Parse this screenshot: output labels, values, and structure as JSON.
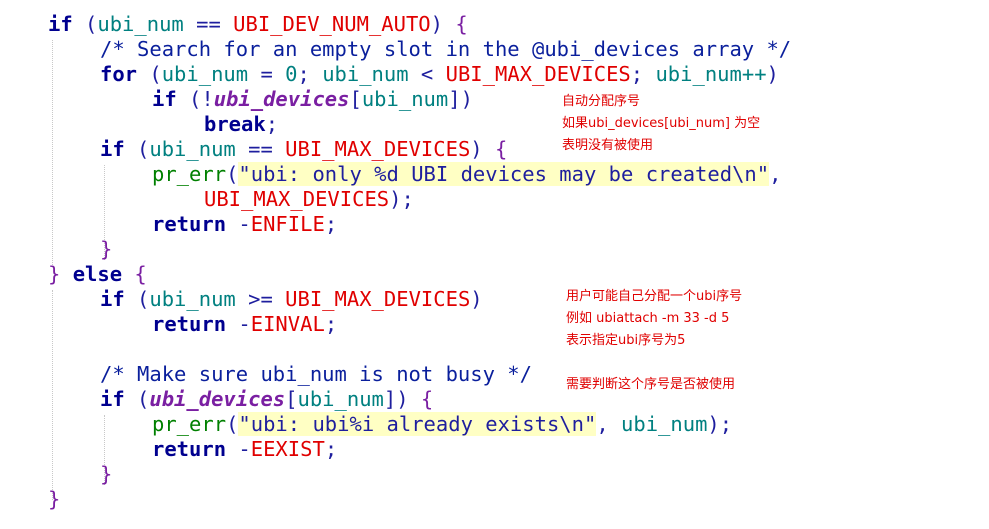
{
  "code": {
    "lines": [
      {
        "tokens": [
          [
            "kw",
            "if"
          ],
          [
            "pn",
            " ("
          ],
          [
            "id",
            "ubi_num"
          ],
          [
            "pn",
            " == "
          ],
          [
            "macro",
            "UBI_DEV_NUM_AUTO"
          ],
          [
            "pn",
            ") "
          ],
          [
            "br",
            "{"
          ]
        ]
      },
      {
        "tokens": [
          [
            "cm",
            "/* Search for an empty slot in the @ubi_devices array */"
          ]
        ]
      },
      {
        "tokens": [
          [
            "kw",
            "for"
          ],
          [
            "pn",
            " ("
          ],
          [
            "id",
            "ubi_num"
          ],
          [
            "pn",
            " = "
          ],
          [
            "id",
            "0"
          ],
          [
            "pn",
            "; "
          ],
          [
            "id",
            "ubi_num"
          ],
          [
            "pn",
            " < "
          ],
          [
            "macro",
            "UBI_MAX_DEVICES"
          ],
          [
            "pn",
            "; "
          ],
          [
            "id",
            "ubi_num++"
          ],
          [
            "pn",
            ")"
          ]
        ]
      },
      {
        "tokens": [
          [
            "kw",
            "if"
          ],
          [
            "pn",
            " (!"
          ],
          [
            "it",
            "ubi_devices"
          ],
          [
            "pn",
            "["
          ],
          [
            "id",
            "ubi_num"
          ],
          [
            "pn",
            "])"
          ]
        ]
      },
      {
        "tokens": [
          [
            "kw",
            "break"
          ],
          [
            "pn",
            ";"
          ]
        ]
      },
      {
        "tokens": [
          [
            "kw",
            "if"
          ],
          [
            "pn",
            " ("
          ],
          [
            "id",
            "ubi_num"
          ],
          [
            "pn",
            " == "
          ],
          [
            "macro",
            "UBI_MAX_DEVICES"
          ],
          [
            "pn",
            ") "
          ],
          [
            "br",
            "{"
          ]
        ]
      },
      {
        "tokens": [
          [
            "fn",
            "pr_err"
          ],
          [
            "pn",
            "("
          ],
          [
            "str",
            "\"ubi: only %d UBI devices may be created\\n\""
          ],
          [
            "pn",
            ","
          ]
        ]
      },
      {
        "tokens": [
          [
            "macro",
            "UBI_MAX_DEVICES"
          ],
          [
            "pn",
            ");"
          ]
        ]
      },
      {
        "tokens": [
          [
            "kw",
            "return"
          ],
          [
            "pn",
            " -"
          ],
          [
            "macro",
            "ENFILE"
          ],
          [
            "pn",
            ";"
          ]
        ]
      },
      {
        "tokens": [
          [
            "br",
            "}"
          ]
        ]
      },
      {
        "tokens": [
          [
            "br",
            "}"
          ],
          [
            "pn",
            " "
          ],
          [
            "kw",
            "else"
          ],
          [
            "pn",
            " "
          ],
          [
            "br",
            "{"
          ]
        ]
      },
      {
        "tokens": [
          [
            "kw",
            "if"
          ],
          [
            "pn",
            " ("
          ],
          [
            "id",
            "ubi_num"
          ],
          [
            "pn",
            " >= "
          ],
          [
            "macro",
            "UBI_MAX_DEVICES"
          ],
          [
            "pn",
            ")"
          ]
        ]
      },
      {
        "tokens": [
          [
            "kw",
            "return"
          ],
          [
            "pn",
            " -"
          ],
          [
            "macro",
            "EINVAL"
          ],
          [
            "pn",
            ";"
          ]
        ]
      },
      {
        "tokens": []
      },
      {
        "tokens": [
          [
            "cm",
            "/* Make sure ubi_num is not busy */"
          ]
        ]
      },
      {
        "tokens": [
          [
            "kw",
            "if"
          ],
          [
            "pn",
            " ("
          ],
          [
            "it",
            "ubi_devices"
          ],
          [
            "pn",
            "["
          ],
          [
            "id",
            "ubi_num"
          ],
          [
            "pn",
            "]) "
          ],
          [
            "br",
            "{"
          ]
        ]
      },
      {
        "tokens": [
          [
            "fn",
            "pr_err"
          ],
          [
            "pn",
            "("
          ],
          [
            "str",
            "\"ubi: ubi%i already exists\\n\""
          ],
          [
            "pn",
            ", "
          ],
          [
            "id",
            "ubi_num"
          ],
          [
            "pn",
            ");"
          ]
        ]
      },
      {
        "tokens": [
          [
            "kw",
            "return"
          ],
          [
            "pn",
            " -"
          ],
          [
            "macro",
            "EEXIST"
          ],
          [
            "pn",
            ";"
          ]
        ]
      },
      {
        "tokens": [
          [
            "br",
            "}"
          ]
        ]
      },
      {
        "tokens": [
          [
            "br",
            "}"
          ]
        ]
      }
    ]
  },
  "annotations": {
    "auto_alloc": [
      "自动分配序号",
      "如果ubi_devices[ubi_num] 为空",
      "表明没有被使用"
    ],
    "user_alloc": [
      "用户可能自己分配一个ubi序号",
      "例如 ubiattach -m 33 -d 5",
      "表示指定ubi序号为5"
    ],
    "check_busy": [
      "需要判断这个序号是否被使用"
    ]
  }
}
